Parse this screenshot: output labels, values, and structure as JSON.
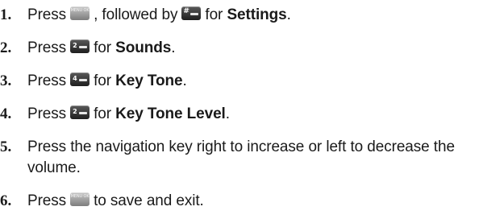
{
  "steps": [
    {
      "number": "1.",
      "press": "Press",
      "key1_label": "MENU OK",
      "mid": ", followed by",
      "key2_label": "#",
      "after": "for",
      "target": "Settings",
      "end": "."
    },
    {
      "number": "2.",
      "press": "Press",
      "key_label": "2",
      "after": "for",
      "target": "Sounds",
      "end": "."
    },
    {
      "number": "3.",
      "press": "Press",
      "key_label": "4",
      "after": "for",
      "target": "Key Tone",
      "end": "."
    },
    {
      "number": "4.",
      "press": "Press",
      "key_label": "2",
      "after": "for",
      "target": "Key Tone Level",
      "end": "."
    },
    {
      "number": "5.",
      "text": "Press the navigation key right to increase or left to decrease the volume."
    },
    {
      "number": "6.",
      "press": "Press",
      "key_label": "MENU OK",
      "after": "to save and exit."
    }
  ],
  "icons": {
    "menu_ok": "menu-ok-key-icon",
    "hash": "hash-key-icon",
    "two": "two-key-icon",
    "four": "four-key-icon"
  },
  "colors": {
    "text": "#1a1a1a",
    "key_dark": "#2a2a2a",
    "key_light": "#a8a8a8"
  }
}
